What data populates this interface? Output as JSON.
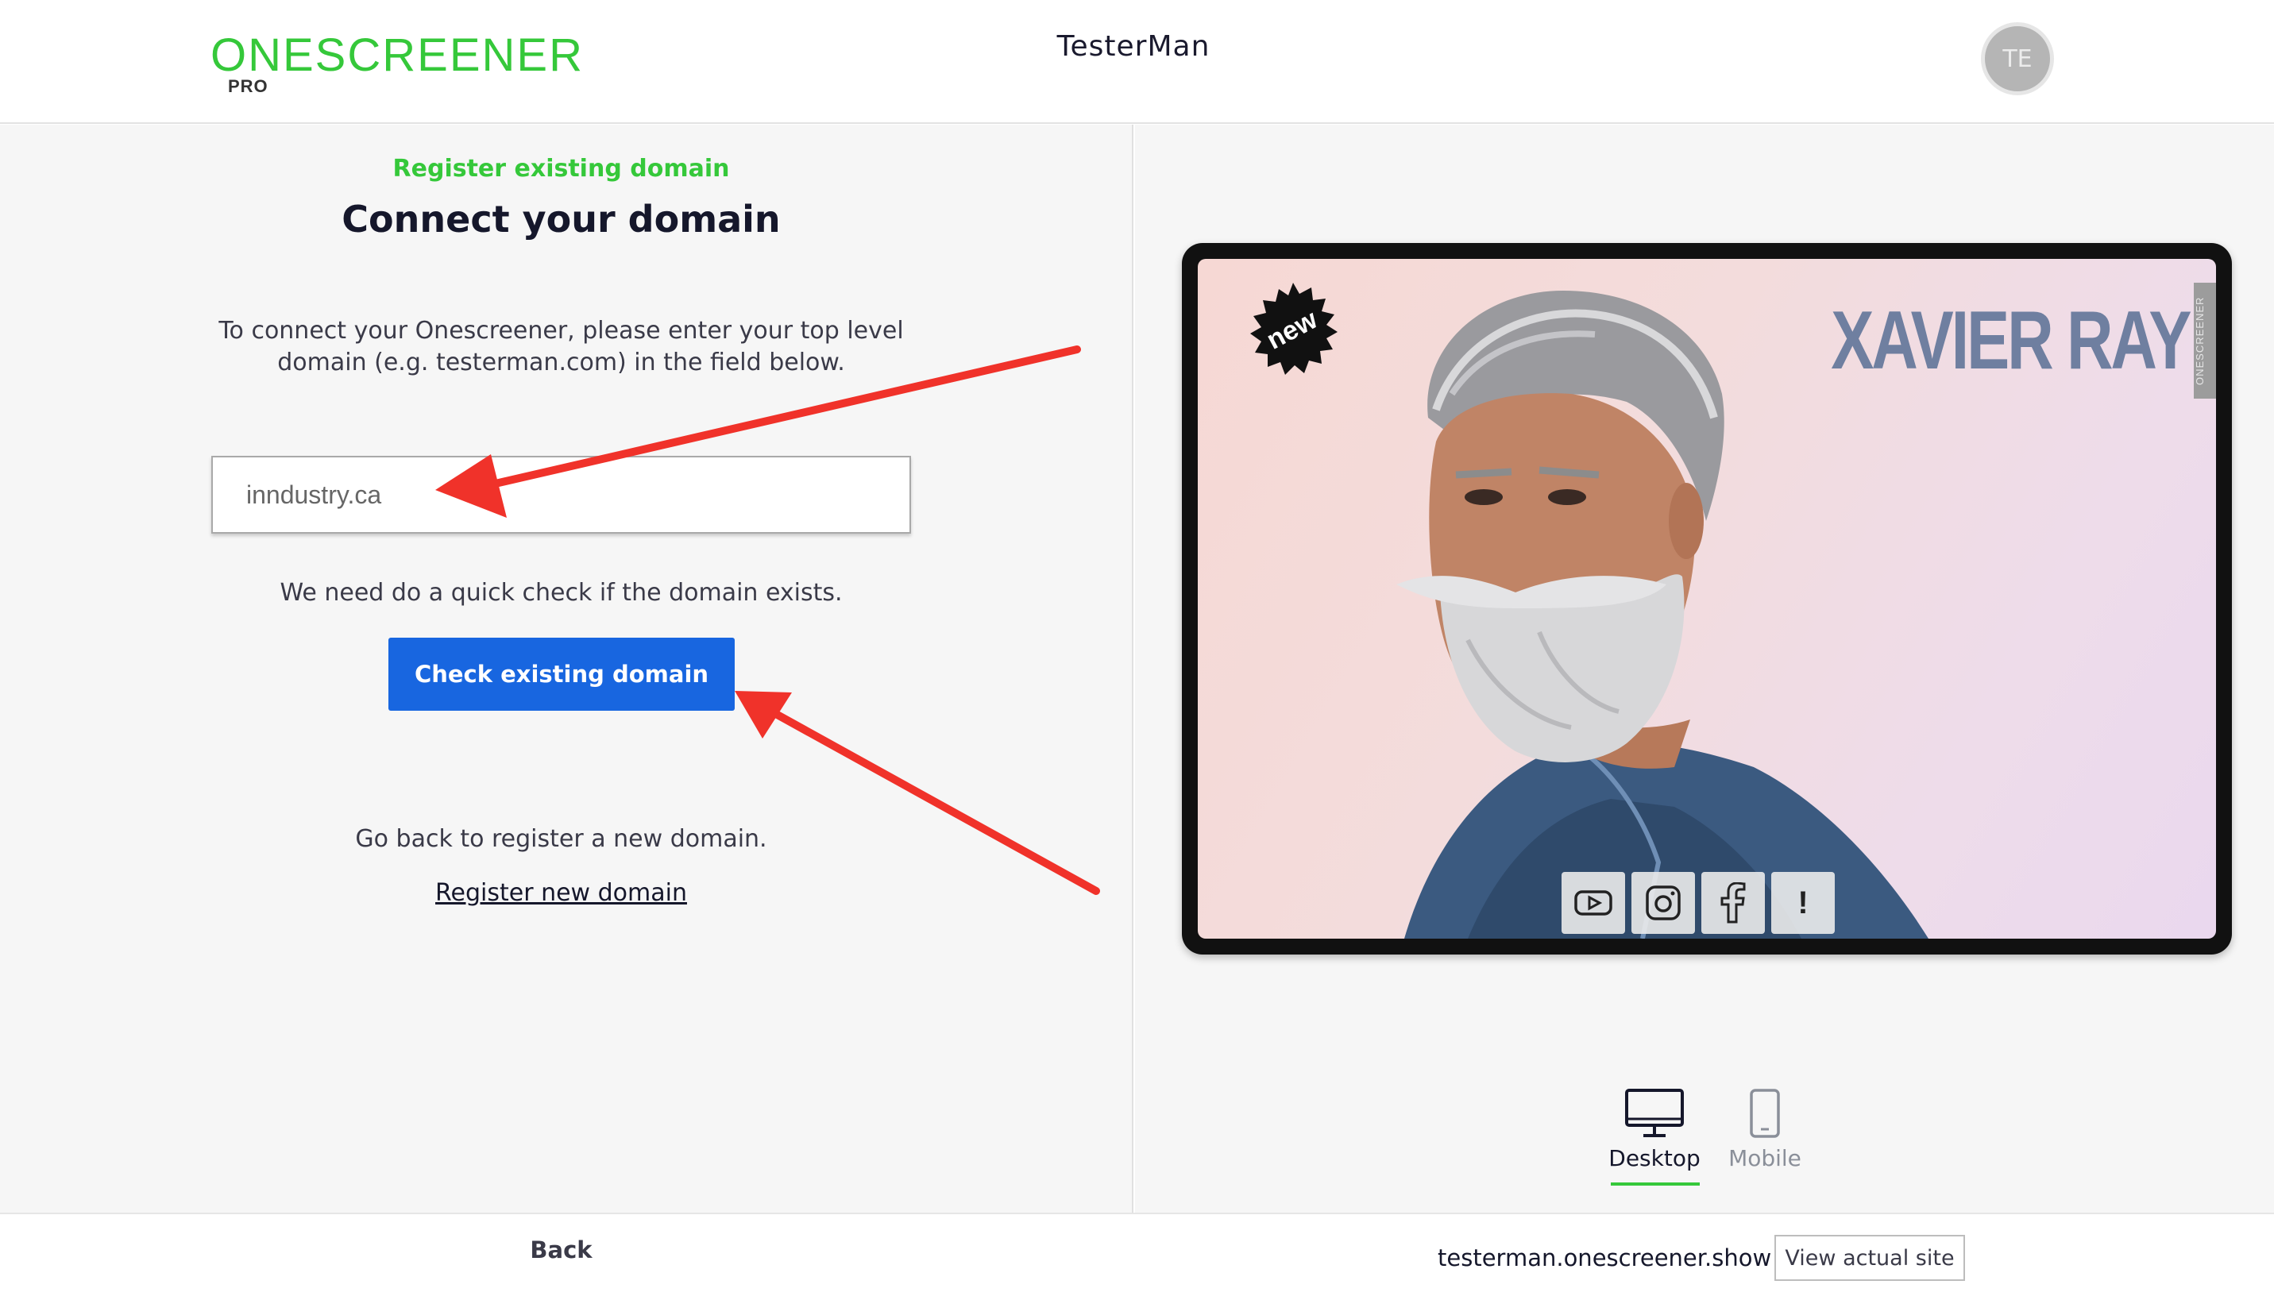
{
  "header": {
    "logo_text": "ONESCREENER",
    "logo_sub": "PRO",
    "site_title": "TesterMan",
    "avatar_initials": "TE"
  },
  "left": {
    "subtitle": "Register existing domain",
    "heading": "Connect your domain",
    "instructions": "To connect your Onescreener, please enter your top level domain (e.g. testerman.com) in the field below.",
    "domain_input_value": "inndustry.ca",
    "check_text": "We need do a quick check if the domain exists.",
    "check_button_label": "Check existing domain",
    "go_back_text": "Go back to register a new domain.",
    "register_link_label": "Register new domain"
  },
  "preview": {
    "badge_text": "new",
    "artist_name": "XAVIER RAY",
    "vertical_tag": "ONESCREENER",
    "social_icons": [
      "youtube-icon",
      "instagram-icon",
      "facebook-icon",
      "exclamation-icon"
    ],
    "exclamation": "!"
  },
  "view_toggle": {
    "desktop_label": "Desktop",
    "mobile_label": "Mobile",
    "active": "Desktop"
  },
  "footer": {
    "back_label": "Back",
    "site_url": "testerman.onescreener.show",
    "view_site_label": "View actual site"
  },
  "colors": {
    "brand_green": "#35c83a",
    "primary_blue": "#1866e0",
    "annotation_red": "#f0322a",
    "panel_bg": "#f6f6f6"
  }
}
